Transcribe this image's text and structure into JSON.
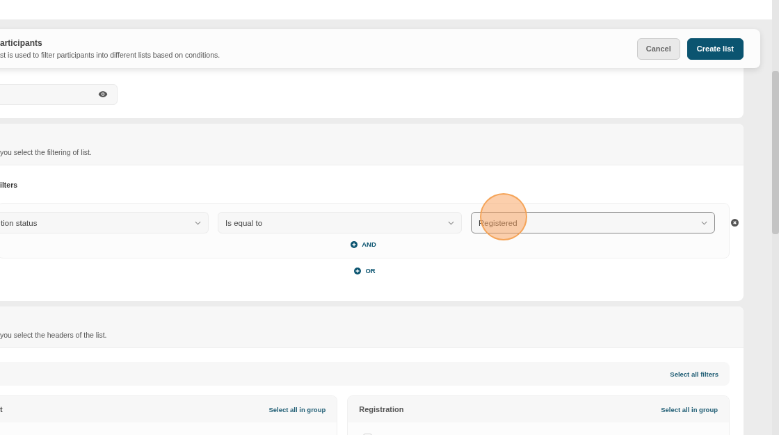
{
  "header": {
    "title": "articipants",
    "description": "st is used to filter participants into different lists based on conditions.",
    "buttons": [
      {
        "label": "Cancel",
        "kind": "secondary"
      },
      {
        "label": "Create list",
        "kind": "primary"
      }
    ]
  },
  "filtering": {
    "description": "you select the filtering of list.",
    "label": "ilters",
    "selects": [
      {
        "value": "tion status",
        "focused": false
      },
      {
        "value": "Is equal to",
        "focused": false
      },
      {
        "value": "Registered",
        "focused": true
      }
    ],
    "and_button": "AND",
    "or_button": "OR"
  },
  "headers": {
    "description": "you select the headers of the list.",
    "select_all_filters": "Select all filters",
    "groups": [
      {
        "title": "t",
        "select_all": "Select all in group"
      },
      {
        "title": "Registration",
        "select_all": "Select all in group",
        "checkbox": {
          "checked": false
        }
      }
    ]
  }
}
